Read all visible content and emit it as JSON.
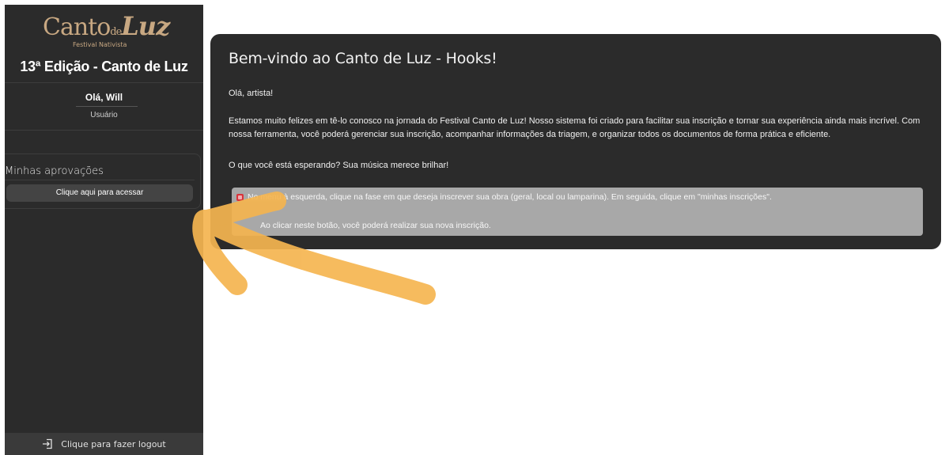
{
  "sidebar": {
    "logo": {
      "script_canto": "Canto",
      "script_de": "de",
      "script_luz": "Luz",
      "subtitle": "Festival Nativista"
    },
    "edition_title": "13ª Edição - Canto de Luz",
    "greeting": "Olá, Will",
    "role": "Usuário",
    "approvals": {
      "title": "Minhas aprovações",
      "button_label": "Clique aqui para acessar"
    },
    "logout_label": "Clique para fazer logout"
  },
  "main": {
    "title": "Bem-vindo ao Canto de Luz - Hooks!",
    "p1": "Olá, artista!",
    "p2": "Estamos muito felizes em tê-lo conosco na jornada do Festival Canto de Luz! Nosso sistema foi criado para facilitar sua inscrição e tornar sua experiência ainda mais incrível. Com nossa ferramenta, você poderá gerenciar sua inscrição, acompanhar informações da triagem, e organizar todos os documentos de forma prática e eficiente.",
    "p3": "O que você está esperando? Sua música merece brilhar!",
    "alert_line1": "No menu à esquerda, clique na fase em que deseja inscrever sua obra (geral, local ou lamparina). Em seguida, clique em \"minhas inscrições\".",
    "alert_line2": "Ao clicar neste botão, você poderá realizar sua nova inscrição."
  },
  "colors": {
    "sidebar_bg": "#2b2b2b",
    "card_bg": "#2b2b2b",
    "logo_gold": "#c8a882",
    "alert_bg": "#a8a8a8",
    "annotation_arrow": "#f5b550"
  },
  "icons": {
    "logout": "logout-icon",
    "alert": "alert-icon",
    "annotation": "annotation-arrow"
  }
}
